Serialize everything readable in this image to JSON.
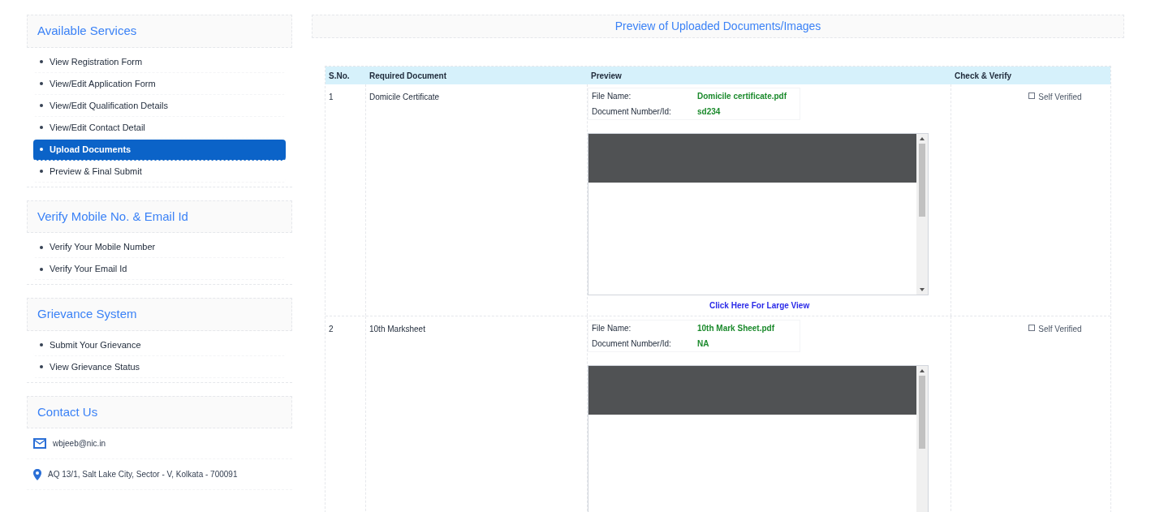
{
  "sidebar": [
    {
      "title": "Available Services",
      "items": [
        {
          "label": "View Registration Form",
          "selected": false
        },
        {
          "label": "View/Edit Application Form",
          "selected": false
        },
        {
          "label": "View/Edit Qualification Details",
          "selected": false
        },
        {
          "label": "View/Edit Contact Detail",
          "selected": false
        },
        {
          "label": "Upload Documents",
          "selected": true
        },
        {
          "label": "Preview & Final Submit",
          "selected": false
        }
      ]
    },
    {
      "title": "Verify Mobile No. & Email Id",
      "items": [
        {
          "label": "Verify Your Mobile Number",
          "selected": false
        },
        {
          "label": "Verify Your Email Id",
          "selected": false
        }
      ]
    },
    {
      "title": "Grievance System",
      "items": [
        {
          "label": "Submit Your Grievance",
          "selected": false
        },
        {
          "label": "View Grievance Status",
          "selected": false
        }
      ]
    }
  ],
  "contact": {
    "title": "Contact Us",
    "items": [
      {
        "kind": "email",
        "text": "wbjeeb@nic.in"
      },
      {
        "kind": "address",
        "text": "AQ 13/1, Salt Lake City, Sector - V, Kolkata - 700091"
      }
    ]
  },
  "main": {
    "title": "Preview of Uploaded Documents/Images",
    "columns": [
      "S.No.",
      "Required Document",
      "Preview",
      "Check & Verify"
    ],
    "rows": [
      {
        "sno": "1",
        "document": "Domicile Certificate",
        "file_name_label": "File Name:",
        "file_name": "Domicile certificate.pdf",
        "doc_number_label": "Document Number/Id:",
        "doc_number": "sd234",
        "link": "Click Here For Large View",
        "verify_label": "Self Verified",
        "checked": false
      },
      {
        "sno": "2",
        "document": "10th Marksheet",
        "file_name_label": "File Name:",
        "file_name": "10th Mark Sheet.pdf",
        "doc_number_label": "Document Number/Id:",
        "doc_number": "NA",
        "verify_label": "Self Verified",
        "checked": false
      }
    ]
  }
}
